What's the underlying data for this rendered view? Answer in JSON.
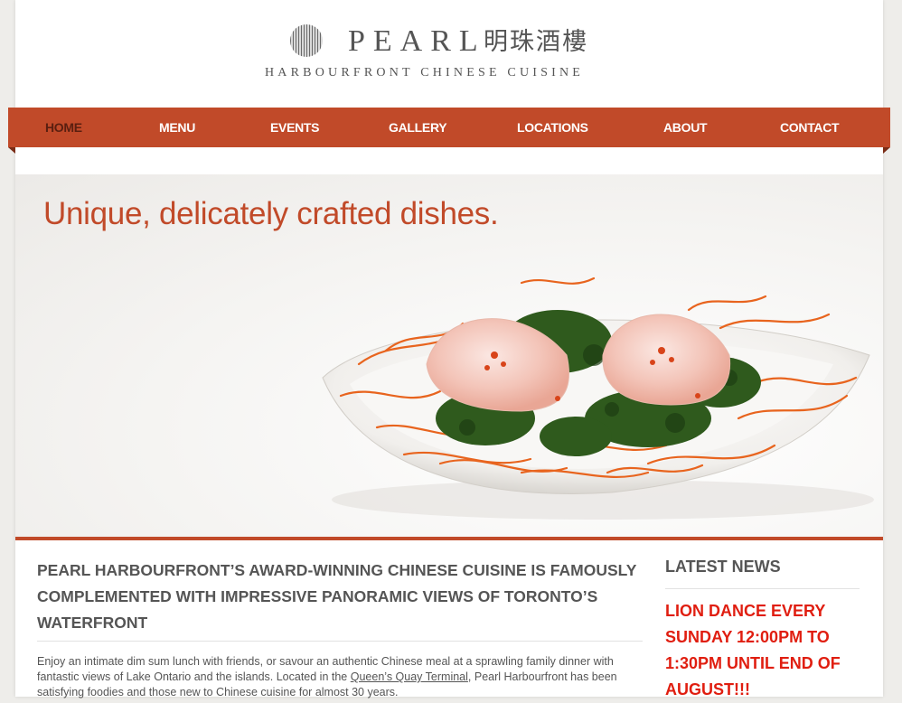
{
  "brand": {
    "name": "PEARL",
    "name_cn": "明珠酒樓",
    "tagline": "HARBOURFRONT CHINESE CUISINE"
  },
  "nav": {
    "items": [
      {
        "label": "HOME",
        "active": true
      },
      {
        "label": "MENU"
      },
      {
        "label": "EVENTS"
      },
      {
        "label": "GALLERY"
      },
      {
        "label": "LOCATIONS"
      },
      {
        "label": "ABOUT"
      },
      {
        "label": "CONTACT"
      }
    ]
  },
  "hero": {
    "title": "Unique, delicately crafted dishes."
  },
  "main": {
    "heading": "PEARL HARBOURFRONT’S AWARD-WINNING CHINESE CUISINE IS FAMOUSLY COMPLEMENTED WITH IMPRESSIVE PANORAMIC VIEWS OF TORONTO’S WATERFRONT",
    "intro_before_link": "Enjoy an intimate dim sum lunch with friends, or savour an authentic Chinese meal at a sprawling family dinner with fantastic views of Lake Ontario and the islands. Located in the ",
    "link_text": "Queen’s Quay Terminal",
    "intro_after_link": ", Pearl Harbourfront has been satisfying foodies and those new to Chinese cuisine for almost 30 years."
  },
  "news": {
    "heading": "LATEST NEWS",
    "item": "LION DANCE EVERY SUNDAY 12:00PM TO 1:30PM UNTIL END OF AUGUST!!!"
  },
  "colors": {
    "accent": "#c14a29",
    "news_red": "#e01e10",
    "text": "#555555"
  }
}
